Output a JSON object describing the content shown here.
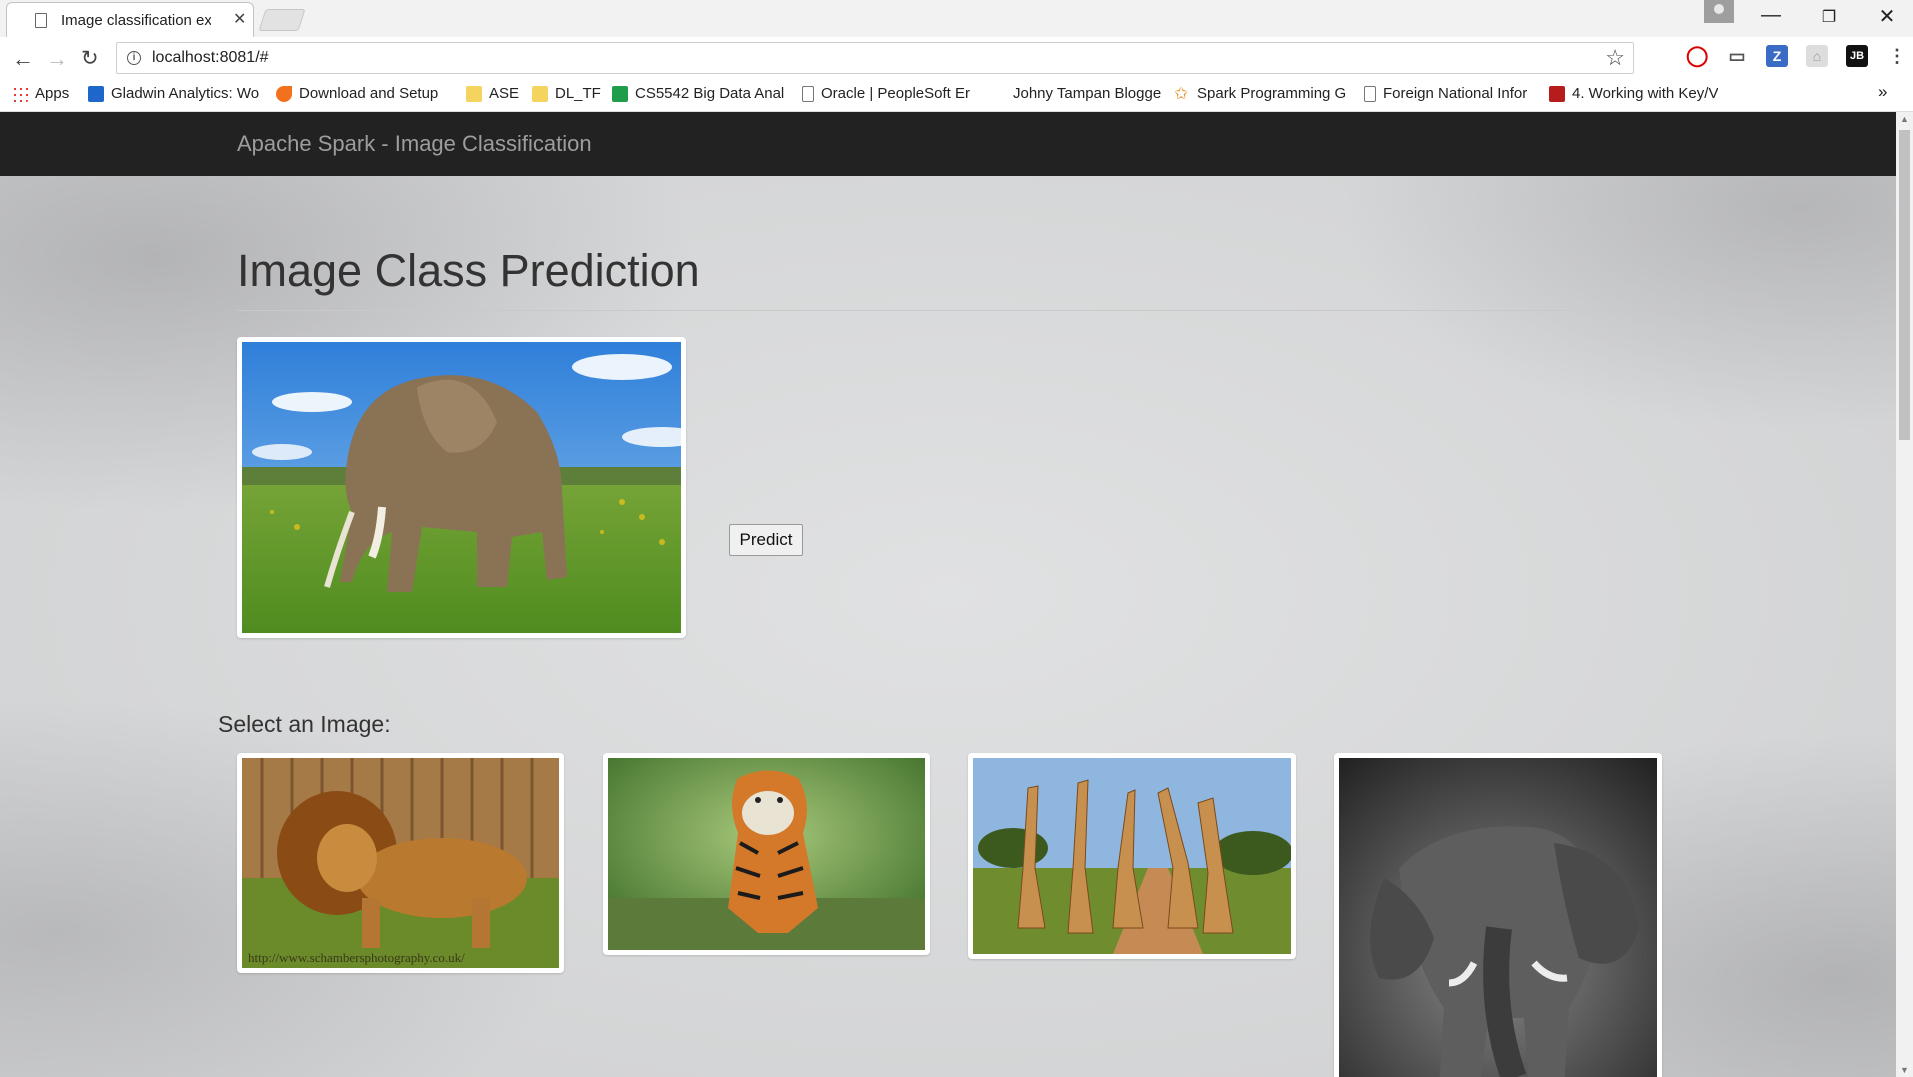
{
  "browser": {
    "tab_title": "Image classification exam",
    "url": "localhost:8081/#",
    "bookmarks": [
      {
        "label": "Apps",
        "icon": "apps-grid-icon",
        "color": "#e53935"
      },
      {
        "label": "Gladwin Analytics: Wo",
        "icon": "g-logo-icon",
        "color": "#1e66c9"
      },
      {
        "label": "Download and Setup",
        "icon": "spark-logo-icon",
        "color": "#f2711c"
      },
      {
        "label": "ASE",
        "icon": "folder-icon",
        "color": "#f4d35e"
      },
      {
        "label": "DL_TF",
        "icon": "folder-icon",
        "color": "#f4d35e"
      },
      {
        "label": "CS5542 Big Data Anal",
        "icon": "sheets-icon",
        "color": "#1e9e4a"
      },
      {
        "label": "Oracle | PeopleSoft Er",
        "icon": "page-icon",
        "color": "#777777"
      },
      {
        "label": "Johny Tampan Blogge",
        "icon": "blank-icon",
        "color": "#ffffff"
      },
      {
        "label": "Spark Programming G",
        "icon": "spark-star-icon",
        "color": "#e8891a"
      },
      {
        "label": "Foreign National Infor",
        "icon": "page-icon",
        "color": "#777777"
      },
      {
        "label": "4. Working with Key/V",
        "icon": "or-logo-icon",
        "color": "#b71c1c"
      }
    ],
    "bookmarks_overflow": "»"
  },
  "app": {
    "brand": "Apache Spark - Image Classification",
    "page_title": "Image Class Prediction",
    "predict_label": "Predict",
    "select_label": "Select an Image:",
    "lion_watermark": "http://www.schambersphotography.co.uk/"
  },
  "colors": {
    "navbar_bg": "#222222",
    "brand_text": "#9d9d9d",
    "page_bg": "#d6d7d8"
  }
}
